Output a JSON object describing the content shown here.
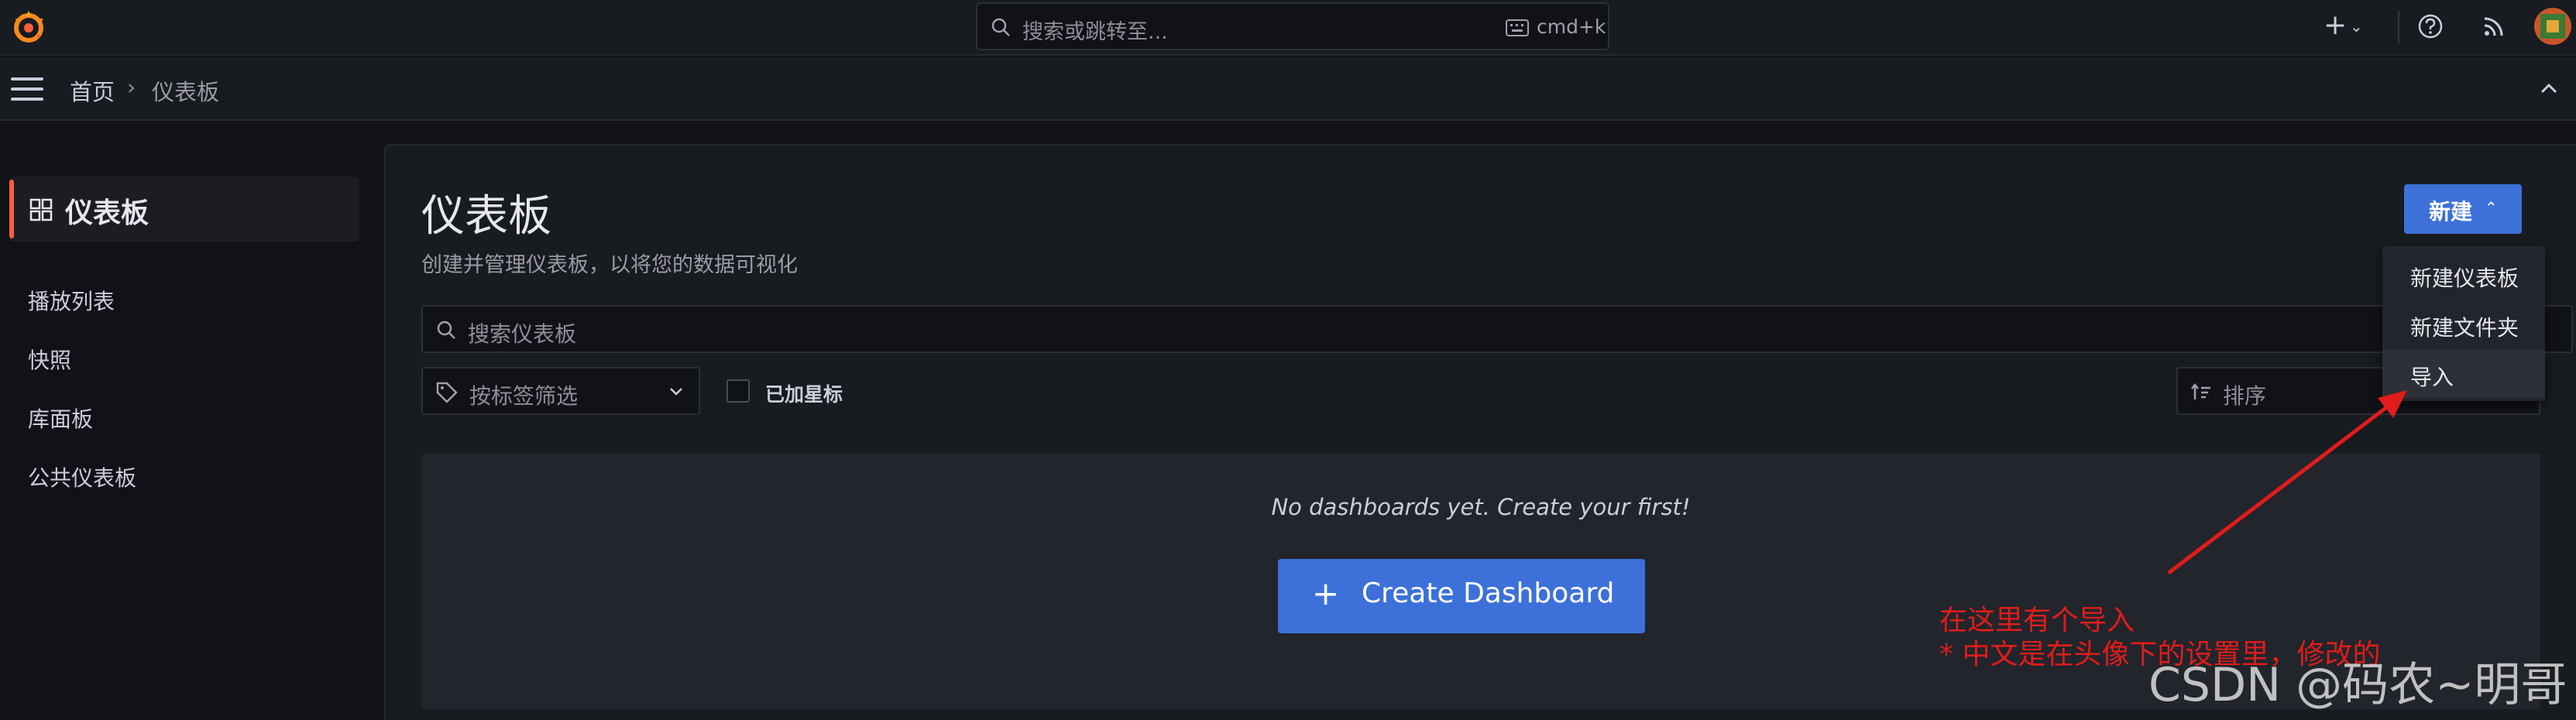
{
  "topbar": {
    "search_placeholder": "搜索或跳转至...",
    "shortcut": "cmd+k",
    "add_label": "+"
  },
  "breadcrumb": {
    "home": "首页",
    "separator": "›",
    "current": "仪表板"
  },
  "sidebar": {
    "active_label": "仪表板",
    "items": [
      {
        "label": "播放列表"
      },
      {
        "label": "快照"
      },
      {
        "label": "库面板"
      },
      {
        "label": "公共仪表板"
      }
    ]
  },
  "main": {
    "title": "仪表板",
    "subtitle": "创建并管理仪表板，以将您的数据可视化",
    "search_placeholder": "搜索仪表板",
    "tag_filter_label": "按标签筛选",
    "starred_label": "已加星标",
    "sort_label": "排序",
    "new_button_label": "新建",
    "empty_message": "No dashboards yet. Create your first!",
    "create_button_label": "Create Dashboard",
    "create_button_icon": "+"
  },
  "new_menu": {
    "items": [
      {
        "label": "新建仪表板"
      },
      {
        "label": "新建文件夹"
      },
      {
        "label": "导入"
      }
    ]
  },
  "annotation": {
    "line1": "在这里有个导入",
    "line2": "* 中文是在头像下的设置里，修改的",
    "color": "#e01c1c"
  },
  "watermark": "CSDN @码农~明哥",
  "colors": {
    "accent": "#3d71d9",
    "brand": "#f55f3e",
    "background": "#111217"
  }
}
